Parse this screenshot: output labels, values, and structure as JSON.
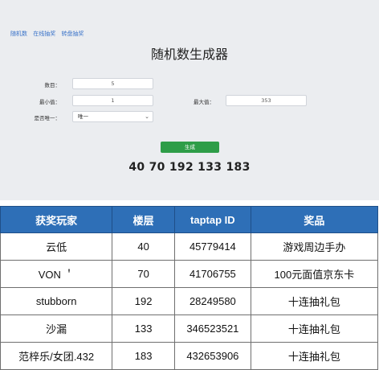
{
  "nav": [
    "随机数",
    "在线抽奖",
    "转盘抽奖"
  ],
  "title": "随机数生成器",
  "form": {
    "count_label": "数目：",
    "count_value": "5",
    "min_label": "最小值：",
    "min_value": "1",
    "max_label": "最大值：",
    "max_value": "353",
    "unique_label": "是否唯一：",
    "unique_value": "唯一"
  },
  "generate_button": "生成",
  "result": "40 70 192 133 183",
  "table": {
    "headers": [
      "获奖玩家",
      "楼层",
      "taptap ID",
      "奖品"
    ],
    "rows": [
      [
        "云低",
        "40",
        "45779414",
        "游戏周边手办"
      ],
      [
        "VON ＇",
        "70",
        "41706755",
        "100元面值京东卡"
      ],
      [
        "stubborn",
        "192",
        "28249580",
        "十连抽礼包"
      ],
      [
        "沙漏",
        "133",
        "346523521",
        "十连抽礼包"
      ],
      [
        "范梓乐/女团.432",
        "183",
        "432653906",
        "十连抽礼包"
      ]
    ]
  },
  "colors": {
    "accent": "#2e9d48",
    "header": "#2e6fb7",
    "link": "#3a73c9"
  }
}
